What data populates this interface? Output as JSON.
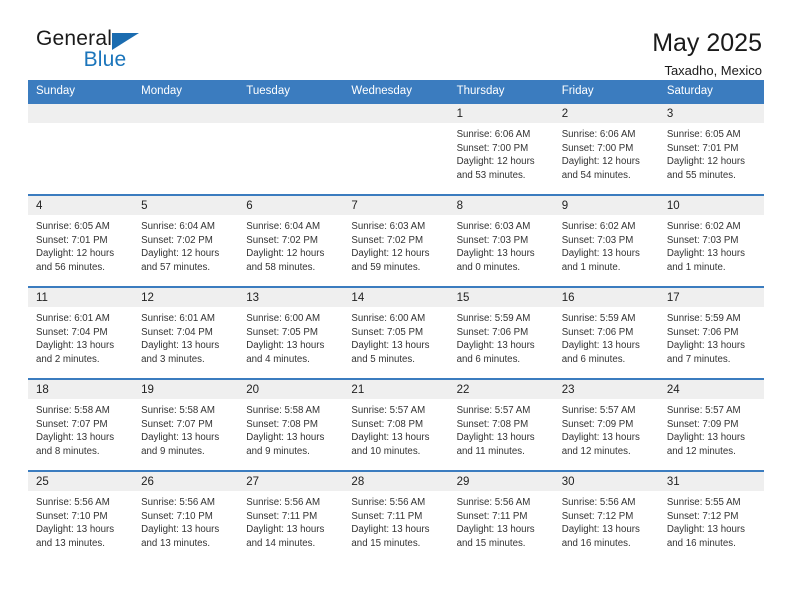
{
  "logo": {
    "word_general": "General",
    "word_blue": "Blue",
    "triangle_color": "#1b6cb0"
  },
  "header": {
    "title": "May 2025",
    "location": "Taxadho, Mexico",
    "header_bg": "#3b7cbf",
    "daynum_bg": "#efefef"
  },
  "weekday_headers": [
    "Sunday",
    "Monday",
    "Tuesday",
    "Wednesday",
    "Thursday",
    "Friday",
    "Saturday"
  ],
  "weeks": [
    [
      {
        "day": "",
        "empty": true
      },
      {
        "day": "",
        "empty": true
      },
      {
        "day": "",
        "empty": true
      },
      {
        "day": "",
        "empty": true
      },
      {
        "day": "1",
        "sunrise": "Sunrise: 6:06 AM",
        "sunset": "Sunset: 7:00 PM",
        "daylight_1": "Daylight: 12 hours",
        "daylight_2": "and 53 minutes."
      },
      {
        "day": "2",
        "sunrise": "Sunrise: 6:06 AM",
        "sunset": "Sunset: 7:00 PM",
        "daylight_1": "Daylight: 12 hours",
        "daylight_2": "and 54 minutes."
      },
      {
        "day": "3",
        "sunrise": "Sunrise: 6:05 AM",
        "sunset": "Sunset: 7:01 PM",
        "daylight_1": "Daylight: 12 hours",
        "daylight_2": "and 55 minutes."
      }
    ],
    [
      {
        "day": "4",
        "sunrise": "Sunrise: 6:05 AM",
        "sunset": "Sunset: 7:01 PM",
        "daylight_1": "Daylight: 12 hours",
        "daylight_2": "and 56 minutes."
      },
      {
        "day": "5",
        "sunrise": "Sunrise: 6:04 AM",
        "sunset": "Sunset: 7:02 PM",
        "daylight_1": "Daylight: 12 hours",
        "daylight_2": "and 57 minutes."
      },
      {
        "day": "6",
        "sunrise": "Sunrise: 6:04 AM",
        "sunset": "Sunset: 7:02 PM",
        "daylight_1": "Daylight: 12 hours",
        "daylight_2": "and 58 minutes."
      },
      {
        "day": "7",
        "sunrise": "Sunrise: 6:03 AM",
        "sunset": "Sunset: 7:02 PM",
        "daylight_1": "Daylight: 12 hours",
        "daylight_2": "and 59 minutes."
      },
      {
        "day": "8",
        "sunrise": "Sunrise: 6:03 AM",
        "sunset": "Sunset: 7:03 PM",
        "daylight_1": "Daylight: 13 hours",
        "daylight_2": "and 0 minutes."
      },
      {
        "day": "9",
        "sunrise": "Sunrise: 6:02 AM",
        "sunset": "Sunset: 7:03 PM",
        "daylight_1": "Daylight: 13 hours",
        "daylight_2": "and 1 minute."
      },
      {
        "day": "10",
        "sunrise": "Sunrise: 6:02 AM",
        "sunset": "Sunset: 7:03 PM",
        "daylight_1": "Daylight: 13 hours",
        "daylight_2": "and 1 minute."
      }
    ],
    [
      {
        "day": "11",
        "sunrise": "Sunrise: 6:01 AM",
        "sunset": "Sunset: 7:04 PM",
        "daylight_1": "Daylight: 13 hours",
        "daylight_2": "and 2 minutes."
      },
      {
        "day": "12",
        "sunrise": "Sunrise: 6:01 AM",
        "sunset": "Sunset: 7:04 PM",
        "daylight_1": "Daylight: 13 hours",
        "daylight_2": "and 3 minutes."
      },
      {
        "day": "13",
        "sunrise": "Sunrise: 6:00 AM",
        "sunset": "Sunset: 7:05 PM",
        "daylight_1": "Daylight: 13 hours",
        "daylight_2": "and 4 minutes."
      },
      {
        "day": "14",
        "sunrise": "Sunrise: 6:00 AM",
        "sunset": "Sunset: 7:05 PM",
        "daylight_1": "Daylight: 13 hours",
        "daylight_2": "and 5 minutes."
      },
      {
        "day": "15",
        "sunrise": "Sunrise: 5:59 AM",
        "sunset": "Sunset: 7:06 PM",
        "daylight_1": "Daylight: 13 hours",
        "daylight_2": "and 6 minutes."
      },
      {
        "day": "16",
        "sunrise": "Sunrise: 5:59 AM",
        "sunset": "Sunset: 7:06 PM",
        "daylight_1": "Daylight: 13 hours",
        "daylight_2": "and 6 minutes."
      },
      {
        "day": "17",
        "sunrise": "Sunrise: 5:59 AM",
        "sunset": "Sunset: 7:06 PM",
        "daylight_1": "Daylight: 13 hours",
        "daylight_2": "and 7 minutes."
      }
    ],
    [
      {
        "day": "18",
        "sunrise": "Sunrise: 5:58 AM",
        "sunset": "Sunset: 7:07 PM",
        "daylight_1": "Daylight: 13 hours",
        "daylight_2": "and 8 minutes."
      },
      {
        "day": "19",
        "sunrise": "Sunrise: 5:58 AM",
        "sunset": "Sunset: 7:07 PM",
        "daylight_1": "Daylight: 13 hours",
        "daylight_2": "and 9 minutes."
      },
      {
        "day": "20",
        "sunrise": "Sunrise: 5:58 AM",
        "sunset": "Sunset: 7:08 PM",
        "daylight_1": "Daylight: 13 hours",
        "daylight_2": "and 9 minutes."
      },
      {
        "day": "21",
        "sunrise": "Sunrise: 5:57 AM",
        "sunset": "Sunset: 7:08 PM",
        "daylight_1": "Daylight: 13 hours",
        "daylight_2": "and 10 minutes."
      },
      {
        "day": "22",
        "sunrise": "Sunrise: 5:57 AM",
        "sunset": "Sunset: 7:08 PM",
        "daylight_1": "Daylight: 13 hours",
        "daylight_2": "and 11 minutes."
      },
      {
        "day": "23",
        "sunrise": "Sunrise: 5:57 AM",
        "sunset": "Sunset: 7:09 PM",
        "daylight_1": "Daylight: 13 hours",
        "daylight_2": "and 12 minutes."
      },
      {
        "day": "24",
        "sunrise": "Sunrise: 5:57 AM",
        "sunset": "Sunset: 7:09 PM",
        "daylight_1": "Daylight: 13 hours",
        "daylight_2": "and 12 minutes."
      }
    ],
    [
      {
        "day": "25",
        "sunrise": "Sunrise: 5:56 AM",
        "sunset": "Sunset: 7:10 PM",
        "daylight_1": "Daylight: 13 hours",
        "daylight_2": "and 13 minutes."
      },
      {
        "day": "26",
        "sunrise": "Sunrise: 5:56 AM",
        "sunset": "Sunset: 7:10 PM",
        "daylight_1": "Daylight: 13 hours",
        "daylight_2": "and 13 minutes."
      },
      {
        "day": "27",
        "sunrise": "Sunrise: 5:56 AM",
        "sunset": "Sunset: 7:11 PM",
        "daylight_1": "Daylight: 13 hours",
        "daylight_2": "and 14 minutes."
      },
      {
        "day": "28",
        "sunrise": "Sunrise: 5:56 AM",
        "sunset": "Sunset: 7:11 PM",
        "daylight_1": "Daylight: 13 hours",
        "daylight_2": "and 15 minutes."
      },
      {
        "day": "29",
        "sunrise": "Sunrise: 5:56 AM",
        "sunset": "Sunset: 7:11 PM",
        "daylight_1": "Daylight: 13 hours",
        "daylight_2": "and 15 minutes."
      },
      {
        "day": "30",
        "sunrise": "Sunrise: 5:56 AM",
        "sunset": "Sunset: 7:12 PM",
        "daylight_1": "Daylight: 13 hours",
        "daylight_2": "and 16 minutes."
      },
      {
        "day": "31",
        "sunrise": "Sunrise: 5:55 AM",
        "sunset": "Sunset: 7:12 PM",
        "daylight_1": "Daylight: 13 hours",
        "daylight_2": "and 16 minutes."
      }
    ]
  ]
}
